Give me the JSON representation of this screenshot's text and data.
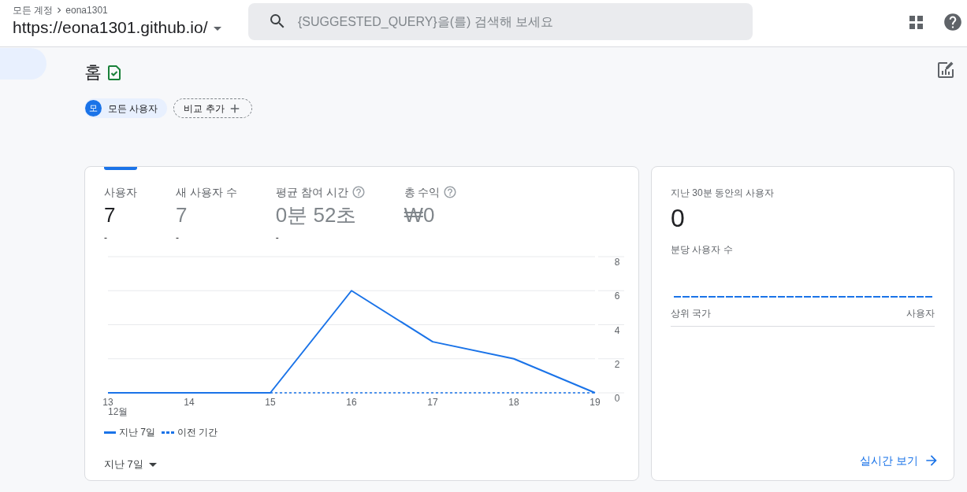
{
  "header": {
    "breadcrumb": {
      "parent": "모든 계정",
      "current": "eona1301"
    },
    "property": "https://eona1301.github.io/",
    "search": {
      "placeholder": "{SUGGESTED_QUERY}을(를) 검색해 보세요"
    }
  },
  "sidebar": {
    "items": [
      {
        "selected": true
      }
    ]
  },
  "page": {
    "title": "홈",
    "segments": [
      {
        "avatar": "모",
        "label": "모든 사용자"
      }
    ],
    "add_comparison": "비교 추가"
  },
  "overview_card": {
    "metrics": [
      {
        "label": "사용자",
        "value": "7",
        "change": "-",
        "help": false,
        "selected": true
      },
      {
        "label": "새 사용자 수",
        "value": "7",
        "change": "-",
        "help": false,
        "selected": false
      },
      {
        "label": "평균 참여 시간",
        "value": "0분 52초",
        "change": "-",
        "help": true,
        "selected": false
      },
      {
        "label": "총 수익",
        "value": "₩0",
        "help": true,
        "selected": false
      }
    ],
    "chart": {
      "month_label": "12월",
      "chart_data": {
        "type": "line",
        "categories": [
          "13",
          "14",
          "15",
          "16",
          "17",
          "18",
          "19"
        ],
        "series": [
          {
            "name": "지난 7일",
            "color": "#1a73e8",
            "line_style": "solid",
            "values": [
              0,
              0,
              0,
              6,
              3,
              2,
              0
            ]
          },
          {
            "name": "이전 기간",
            "color": "#1a73e8",
            "line_style": "dashed",
            "values": [
              null,
              null,
              0,
              0,
              0,
              0,
              0
            ]
          }
        ],
        "ylim": [
          0,
          8
        ],
        "yticks": [
          0,
          2,
          4,
          6,
          8
        ],
        "grid": true
      }
    },
    "date_range": "지난 7일"
  },
  "realtime_card": {
    "title": "지난 30분 동안의 사용자",
    "value": "0",
    "per_minute_label": "분당 사용자 수",
    "table": {
      "columns": [
        "상위 국가",
        "사용자"
      ]
    },
    "link": "실시간 보기"
  }
}
